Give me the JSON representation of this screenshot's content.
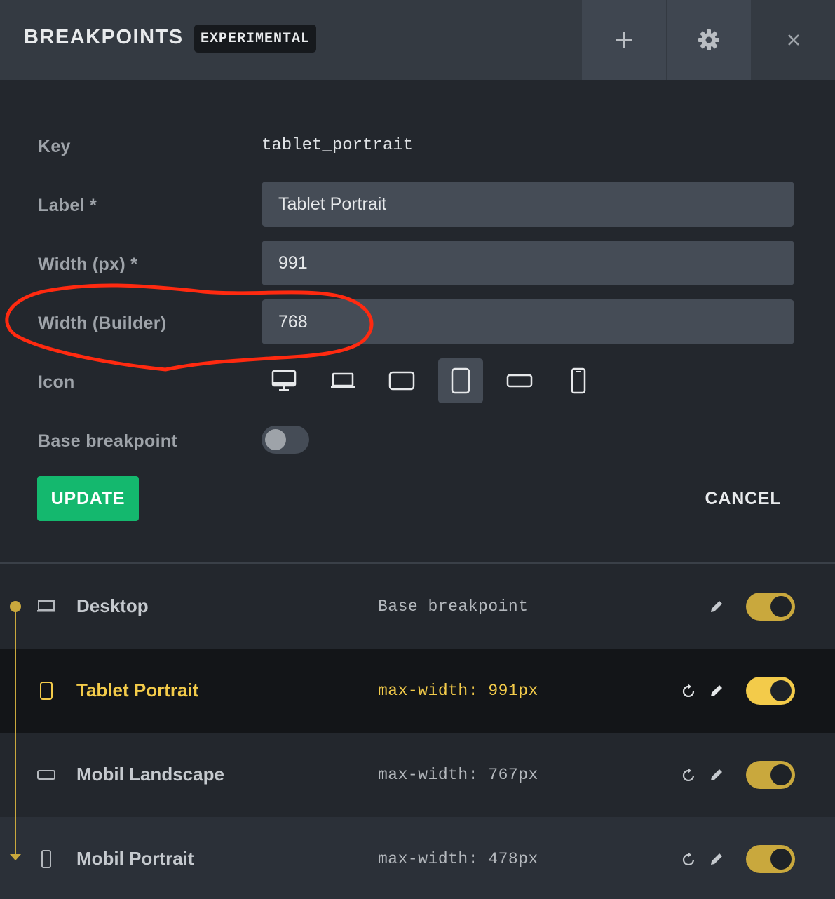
{
  "header": {
    "title": "BREAKPOINTS",
    "badge": "EXPERIMENTAL",
    "add_icon": "plus-icon",
    "settings_icon": "gear-icon",
    "close_icon": "close-icon"
  },
  "form": {
    "key_label": "Key",
    "key_value": "tablet_portrait",
    "label_label": "Label *",
    "label_value": "Tablet Portrait",
    "width_label": "Width (px) *",
    "width_value": "991",
    "builder_label": "Width (Builder)",
    "builder_value": "768",
    "icon_label": "Icon",
    "icons": [
      "desktop-icon",
      "laptop-icon",
      "tablet-landscape-icon",
      "tablet-portrait-icon",
      "mobile-landscape-icon",
      "mobile-portrait-icon"
    ],
    "selected_icon": "tablet-portrait-icon",
    "base_label": "Base breakpoint",
    "base_enabled": false,
    "update_label": "UPDATE",
    "cancel_label": "CANCEL"
  },
  "breakpoints": [
    {
      "name": "Desktop",
      "meta": "Base breakpoint",
      "icon": "laptop-icon",
      "enabled": true,
      "active": false
    },
    {
      "name": "Tablet Portrait",
      "meta": "max-width: 991px",
      "icon": "tablet-portrait-icon",
      "enabled": true,
      "active": true
    },
    {
      "name": "Mobil Landscape",
      "meta": "max-width: 767px",
      "icon": "mobile-landscape-icon",
      "enabled": true,
      "active": false
    },
    {
      "name": "Mobil Portrait",
      "meta": "max-width: 478px",
      "icon": "mobile-portrait-icon",
      "enabled": true,
      "active": false
    }
  ],
  "colors": {
    "accent": "#f3cb4a",
    "toggle_on": "#c9a83d",
    "update_green": "#14b86e",
    "annotation_red": "#ff2a10"
  }
}
